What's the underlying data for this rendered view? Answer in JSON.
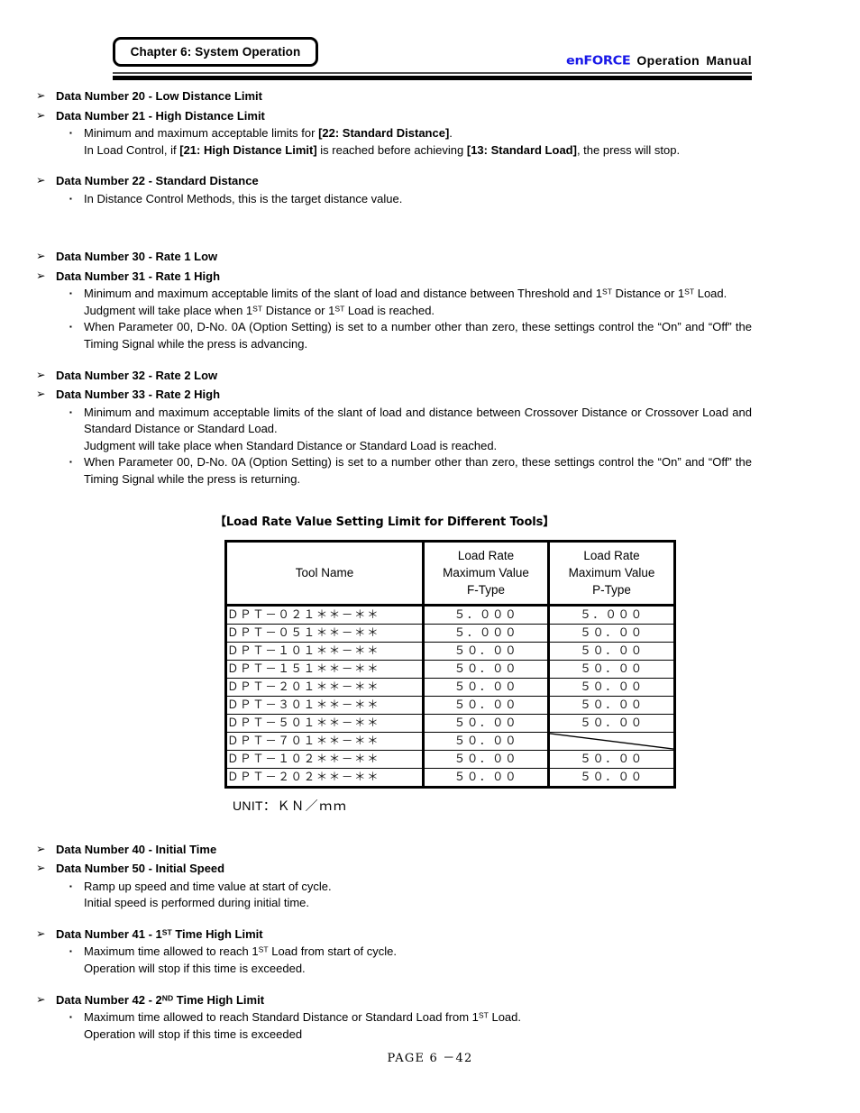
{
  "header": {
    "chapter_box": "Chapter 6: System Operation",
    "brand": "enFORCE",
    "manual_title": "Operation  Manual",
    "brand_color": "#1818e8"
  },
  "bullets": {
    "arrow": "➢",
    "square": "▪"
  },
  "sections": [
    {
      "id": "dn20-21",
      "headings": [
        "Data Number 20 - Low Distance Limit",
        "Data Number 21 - High Distance Limit"
      ],
      "items": [
        {
          "lines": [
            "Minimum and maximum acceptable limits for [22: Standard Distance].",
            "In Load Control, if [21: High Distance Limit] is reached before achieving [13: Standard Load], the press will stop."
          ]
        }
      ]
    },
    {
      "id": "dn22",
      "headings": [
        "Data Number 22 - Standard Distance"
      ],
      "items": [
        {
          "lines": [
            "In Distance Control Methods, this is the target distance value."
          ]
        }
      ]
    },
    {
      "id": "dn30-31",
      "headings": [
        "Data Number 30 - Rate 1 Low",
        "Data Number 31 - Rate 1 High"
      ],
      "items": [
        {
          "lines": [
            "Minimum and maximum acceptable limits of the slant of load and distance between Threshold and 1ST Distance or 1ST Load.",
            "Judgment will take place when 1ST Distance or 1ST Load is reached."
          ]
        },
        {
          "lines": [
            "When Parameter 00, D-No. 0A (Option Setting) is set to a number other than zero, these settings control the “On” and “Off” the Timing Signal while the press is advancing."
          ]
        }
      ]
    },
    {
      "id": "dn32-33",
      "headings": [
        "Data Number 32 - Rate 2 Low",
        "Data Number 33 - Rate 2 High"
      ],
      "items": [
        {
          "lines": [
            "Minimum and maximum acceptable limits of the slant of load and distance between Crossover Distance or Crossover Load and Standard Distance or Standard Load.",
            "Judgment will take place when Standard Distance or Standard Load is reached."
          ]
        },
        {
          "lines": [
            "When Parameter 00, D-No. 0A (Option Setting) is set to a number other than zero, these settings control the “On” and “Off” the Timing Signal while the press is returning."
          ]
        }
      ]
    },
    {
      "id": "dn40-50",
      "headings": [
        "Data Number 40 - Initial Time",
        "Data Number 50 - Initial Speed"
      ],
      "items": [
        {
          "lines": [
            "Ramp up speed and time value at start of cycle.",
            "Initial speed is performed during initial time."
          ]
        }
      ]
    },
    {
      "id": "dn41",
      "headings": [
        "Data Number 41 - 1ST Time High Limit"
      ],
      "items": [
        {
          "lines": [
            "Maximum time allowed to reach 1ST Load from start of cycle.",
            "Operation will stop if this time is exceeded."
          ]
        }
      ]
    },
    {
      "id": "dn42",
      "headings": [
        "Data Number 42 - 2ND Time High Limit"
      ],
      "items": [
        {
          "lines": [
            "Maximum time allowed to reach Standard Distance or Standard Load from 1ST Load.",
            "Operation will stop if this time is exceeded"
          ]
        }
      ]
    }
  ],
  "text": {
    "h_dn20": "Data Number 20 - Low Distance Limit",
    "h_dn21": "Data Number 21 - High Distance Limit",
    "h_dn22": "Data Number 22 - Standard Distance",
    "h_dn30": "Data Number 30 - Rate 1 Low",
    "h_dn31": "Data Number 31 - Rate 1 High",
    "h_dn32": "Data Number 32 - Rate 2 Low",
    "h_dn33": "Data Number 33 - Rate 2 High",
    "h_dn40": "Data Number 40 - Initial Time",
    "h_dn50": "Data Number 50 - Initial Speed",
    "p_dn22": "In Distance Control Methods, this is the target distance value.",
    "p_dn40a": "Ramp up speed and time value at start of cycle.",
    "p_dn40b": "Initial speed is performed during initial time.",
    "p_dn41a_pre": "Maximum time allowed to reach 1",
    "p_dn41a_post": " Load from start of cycle.",
    "p_dn41b": "Operation will stop if this time is exceeded.",
    "p_dn42a_pre": "Maximum time allowed to reach Standard Distance or Standard Load from 1",
    "p_dn42a_post": " Load.",
    "p_dn42b": "Operation will stop if this time is exceeded",
    "h_dn41_pre": "Data Number 41 - 1",
    "h_dn41_post": " Time High Limit",
    "h_dn42_pre": "Data Number 42 - 2",
    "h_dn42_post": " Time High Limit",
    "sup_st": "ST",
    "sup_nd": "ND",
    "dn21_l1_a": "Minimum and maximum acceptable limits for ",
    "dn21_l1_b": "[22: Standard Distance]",
    "dn21_l1_c": ".",
    "dn21_l2_a": "In Load Control, if ",
    "dn21_l2_b": "[21: High Distance Limit]",
    "dn21_l2_c": " is reached before achieving ",
    "dn21_l2_d": "[13: Standard Load]",
    "dn21_l2_e": ", the press will stop.",
    "dn31_l1_pre": "Minimum and maximum acceptable limits of the slant of load and distance between Threshold and 1",
    "dn31_l1_mid": " Distance or 1",
    "dn31_l1_post": " Load.",
    "dn31_l2_pre": "Judgment will take place when 1",
    "dn31_l2_mid": " Distance or 1",
    "dn31_l2_post": " Load is reached.",
    "param_advancing": "When Parameter 00, D-No. 0A (Option Setting) is set to a number other than zero, these settings control the “On” and “Off” the Timing Signal while the press is advancing.",
    "param_returning": "When Parameter 00, D-No. 0A (Option Setting) is set to a number other than zero, these settings control the “On” and “Off” the Timing Signal while the press is returning.",
    "dn33_l1": "Minimum and maximum acceptable limits of the slant of load and distance between Crossover Distance or Crossover Load and Standard Distance or Standard Load.",
    "dn33_l2": "Judgment will take place when Standard Distance or Standard Load is reached."
  },
  "table": {
    "caption": "【Load Rate Value Setting Limit for Different Tools】",
    "columns": [
      {
        "key": "tool",
        "label": "Tool Name"
      },
      {
        "key": "ftype",
        "label": "Load Rate\nMaximum Value\nF-Type",
        "l1": "Load Rate",
        "l2": "Maximum Value",
        "l3": "F-Type"
      },
      {
        "key": "ptype",
        "label": "Load Rate\nMaximum Value\nP-Type",
        "l1": "Load Rate",
        "l2": "Maximum Value",
        "l3": "P-Type"
      }
    ],
    "rows": [
      {
        "tool": "ＤＰＴ－０２１＊＊－＊＊",
        "ftype": "５．０００",
        "ptype": "５．０００",
        "ptype_na": false
      },
      {
        "tool": "ＤＰＴ－０５１＊＊－＊＊",
        "ftype": "５．０００",
        "ptype": "５０．００",
        "ptype_na": false
      },
      {
        "tool": "ＤＰＴ－１０１＊＊－＊＊",
        "ftype": "５０．００",
        "ptype": "５０．００",
        "ptype_na": false
      },
      {
        "tool": "ＤＰＴ－１５１＊＊－＊＊",
        "ftype": "５０．００",
        "ptype": "５０．００",
        "ptype_na": false
      },
      {
        "tool": "ＤＰＴ－２０１＊＊－＊＊",
        "ftype": "５０．００",
        "ptype": "５０．００",
        "ptype_na": false
      },
      {
        "tool": "ＤＰＴ－３０１＊＊－＊＊",
        "ftype": "５０．００",
        "ptype": "５０．００",
        "ptype_na": false
      },
      {
        "tool": "ＤＰＴ－５０１＊＊－＊＊",
        "ftype": "５０．００",
        "ptype": "５０．００",
        "ptype_na": false
      },
      {
        "tool": "ＤＰＴ－７０１＊＊－＊＊",
        "ftype": "５０．００",
        "ptype": "",
        "ptype_na": true
      },
      {
        "tool": "ＤＰＴ－１０２＊＊－＊＊",
        "ftype": "５０．００",
        "ptype": "５０．００",
        "ptype_na": false
      },
      {
        "tool": "ＤＰＴ－２０２＊＊－＊＊",
        "ftype": "５０．００",
        "ptype": "５０．００",
        "ptype_na": false
      }
    ],
    "unit_label": "UNIT",
    "unit_sep": "：",
    "unit_value": "ＫＮ／ｍｍ"
  },
  "footer": {
    "page": "PAGE  6 －42"
  }
}
